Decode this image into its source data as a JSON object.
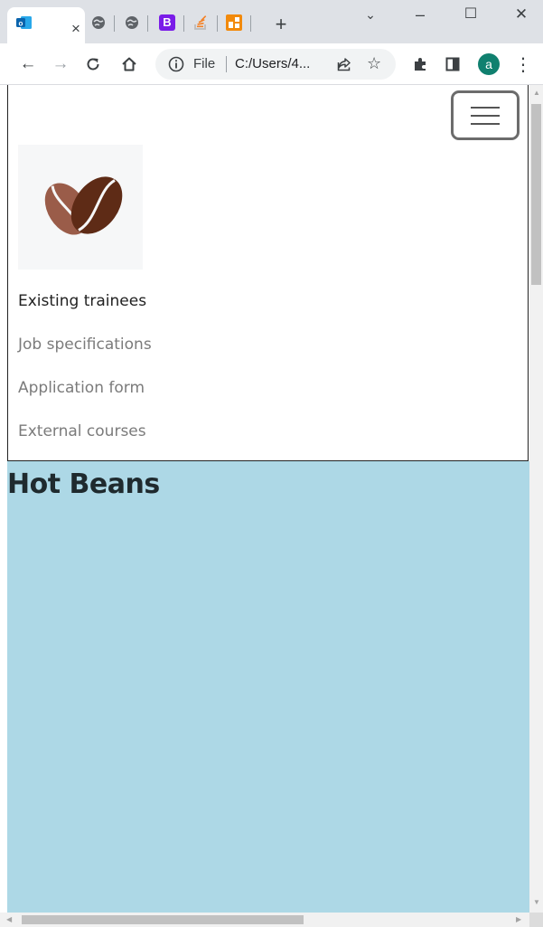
{
  "browser": {
    "tabs": [
      {
        "favicon": "outlook-icon",
        "active": true,
        "close_glyph": "×"
      },
      {
        "favicon": "globe-icon"
      },
      {
        "favicon": "globe-icon"
      },
      {
        "favicon": "bootstrap-icon",
        "glyph": "B"
      },
      {
        "favicon": "stackoverflow-icon"
      },
      {
        "favicon": "dev-icon"
      }
    ],
    "new_tab": "+",
    "window_controls": {
      "dropdown": "⌄",
      "minimize": "–",
      "maximize": "☐",
      "close": "✕"
    },
    "toolbar": {
      "back": "←",
      "forward": "→",
      "reload": "C",
      "home": "⌂",
      "scheme_label": "File",
      "url": "C:/Users/4...",
      "star": "☆",
      "avatar_letter": "a",
      "menu": "⋮"
    }
  },
  "page": {
    "nav_links": [
      {
        "label": "Existing trainees",
        "active": true
      },
      {
        "label": "Job specifications",
        "active": false
      },
      {
        "label": "Application form",
        "active": false
      },
      {
        "label": "External courses",
        "active": false
      }
    ],
    "brand_title": "Hot Beans"
  },
  "colors": {
    "content_bg": "#add8e6",
    "bean_light": "#9a5c49",
    "bean_dark": "#5e2b16",
    "avatar": "#10806f",
    "tab_strip": "#dee1e6"
  }
}
